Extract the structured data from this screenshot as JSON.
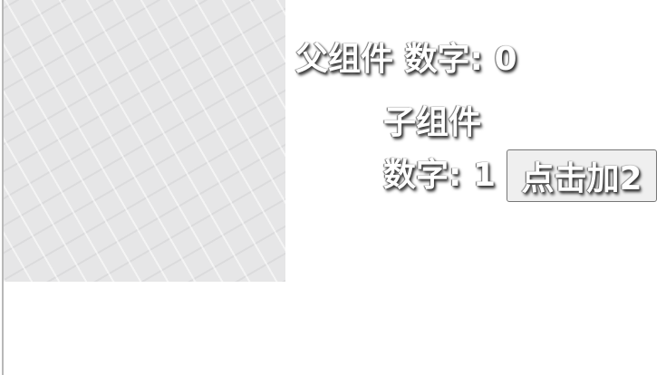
{
  "parent": {
    "label": "父组件 数字: ",
    "count": "0"
  },
  "child": {
    "title": "子组件",
    "count_label": "数字: ",
    "count": "1",
    "button_label": "点击加2"
  }
}
